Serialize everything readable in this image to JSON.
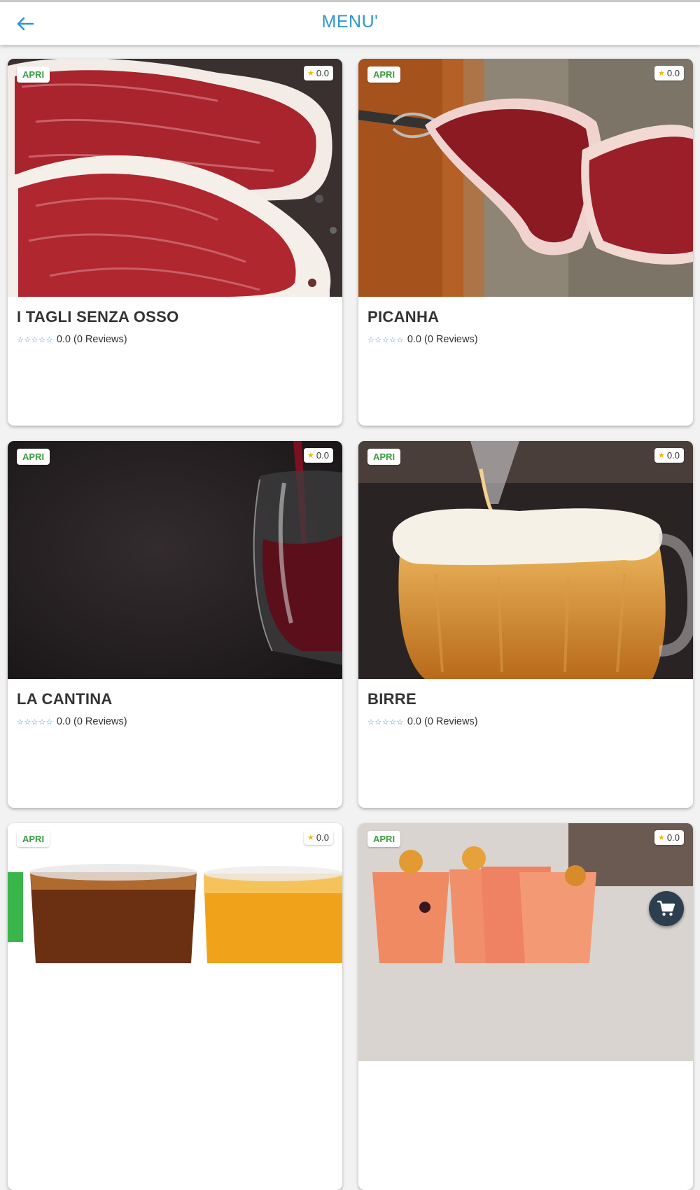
{
  "header": {
    "title": "MENU'"
  },
  "icons": {
    "back": "arrow-left-icon",
    "cart": "shopping-cart-icon",
    "rating": "star-icon"
  },
  "colors": {
    "accent": "#2f97d1",
    "open": "#3a9c3f",
    "star": "#f2b705",
    "fab": "#2c3e50"
  },
  "categories": [
    {
      "name": "I TAGLI SENZA OSSO",
      "status": "APRI",
      "rating": "0.0",
      "stars": "☆☆☆☆☆",
      "reviews": "0.0 (0 Reviews)"
    },
    {
      "name": "PICANHA",
      "status": "APRI",
      "rating": "0.0",
      "stars": "☆☆☆☆☆",
      "reviews": "0.0 (0 Reviews)"
    },
    {
      "name": "LA CANTINA",
      "status": "APRI",
      "rating": "0.0",
      "stars": "☆☆☆☆☆",
      "reviews": "0.0 (0 Reviews)"
    },
    {
      "name": "BIRRE",
      "status": "APRI",
      "rating": "0.0",
      "stars": "☆☆☆☆☆",
      "reviews": "0.0 (0 Reviews)"
    },
    {
      "status": "APRI",
      "rating": "0.0"
    },
    {
      "status": "APRI",
      "rating": "0.0"
    }
  ]
}
